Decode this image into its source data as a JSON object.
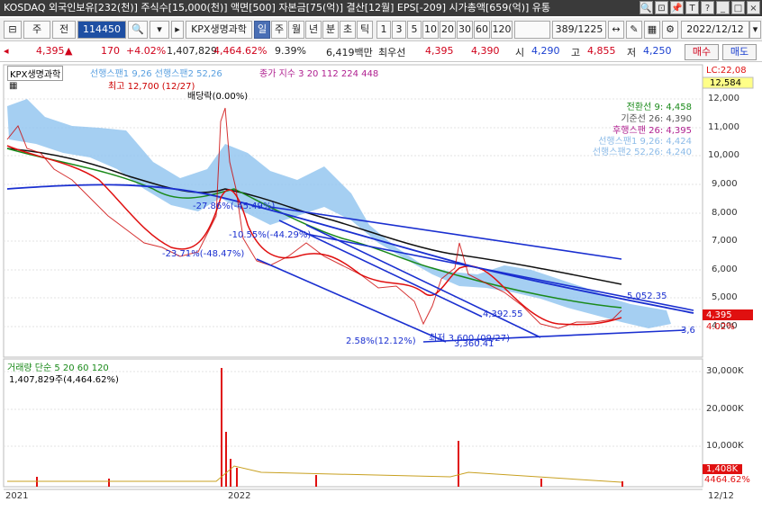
{
  "window": {
    "title": "KOSDAQ 외국인보유[232(천)] 주식수[15,000(천)] 액면[500] 자본금[75(억)] 결산[12월] EPS[-209] 시가총액[659(억)] 유통",
    "buttons": [
      "🔍",
      "⊡",
      "📌",
      "T",
      "?",
      "_",
      "□",
      "×"
    ]
  },
  "toolbar": {
    "type_label": "주",
    "market_label": "전",
    "code_value": "114450",
    "name_label": "KPX생명과학",
    "period_tabs": [
      "일",
      "주",
      "월",
      "년",
      "분",
      "초",
      "틱"
    ],
    "active_period": "일",
    "intervals": [
      "1",
      "3",
      "5",
      "10",
      "20",
      "30",
      "60",
      "120"
    ],
    "page_count": "389/1225",
    "date_value": "2022/12/12"
  },
  "quote": {
    "price": "4,395",
    "arrow": "▲",
    "change": "170",
    "change_pct": "+4.02%",
    "volume": "1,407,829",
    "volume_pct": "4,464.62%",
    "ratio": "9.39%",
    "amount": "6,419백만",
    "pref_label": "최우선",
    "ask": "4,395",
    "bid": "4,390",
    "open_label": "시",
    "open": "4,290",
    "high_label": "고",
    "high": "4,855",
    "low_label": "저",
    "low": "4,250",
    "buy_button": "매수",
    "sell_button": "매도"
  },
  "chart": {
    "name_label": "KPX생명과학",
    "legend_line1": "선행스팬1 9,26  선행스팬2 52,26",
    "legend_ma": "종가 지수 3  20  112  224  448",
    "lc_label": "LC:22,08",
    "lc_value": "12,584",
    "high_annot": "최고 12,700 (12/27)",
    "dividend_annot": "배당락(0.00%)",
    "ichimoku_labels": [
      "전환선 9: 4,458",
      "기준선 26: 4,390",
      "후행스팬 26: 4,395",
      "선행스팬1 9,26: 4,424",
      "선행스팬2 52,26: 4,240"
    ],
    "annotations": [
      "-27.86%(-45.49%)",
      "-10.55%(-44.29%)",
      "-23.71%(-48.47%)",
      "5,052.35",
      "4,392.55",
      "최저 3,600 (09/27)",
      "2.58%(12.12%)",
      "3,360.41",
      "3,6"
    ],
    "price_axis": [
      "12,000",
      "11,000",
      "10,000",
      "9,000",
      "8,000",
      "7,000",
      "6,000",
      "5,000",
      "4,000"
    ],
    "current_price_tag": "4,395",
    "current_pct_tag": "4.02%",
    "volume_legend": "거래량  단순 5  20  60  120",
    "volume_value": "1,407,829주(4,464.62%)",
    "volume_axis": [
      "30,000K",
      "20,000K",
      "10,000K"
    ],
    "volume_tag": "1,408K",
    "volume_pct_tag": "4464.62%",
    "x_labels": [
      "2021",
      "2022",
      "12/12"
    ]
  }
}
